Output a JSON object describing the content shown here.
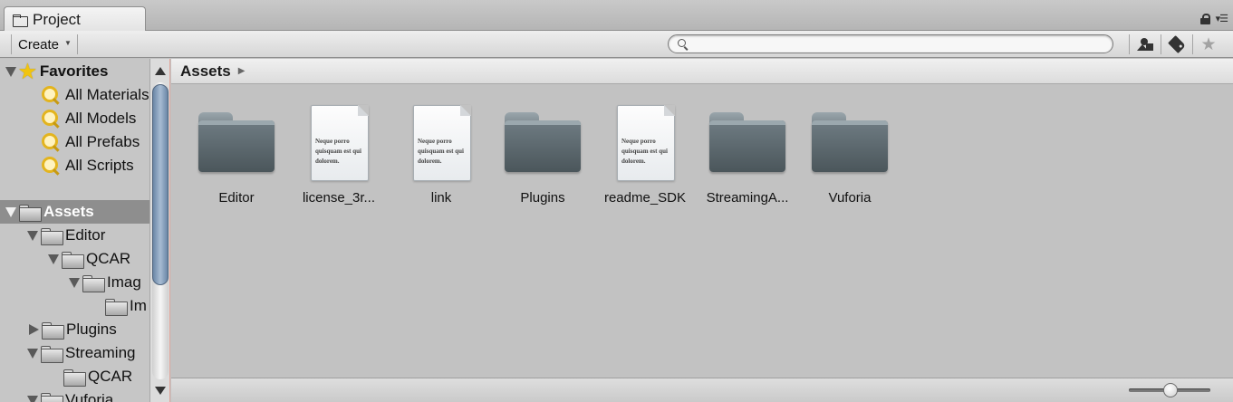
{
  "tab": {
    "title": "Project"
  },
  "toolbar": {
    "create_label": "Create",
    "search_placeholder": ""
  },
  "sidebar": {
    "favorites_label": "Favorites",
    "favorites": [
      "All Materials",
      "All Models",
      "All Prefabs",
      "All Scripts"
    ],
    "assets_label": "Assets",
    "tree": [
      {
        "label": "Editor",
        "depth": 1,
        "state": "expanded"
      },
      {
        "label": "QCAR",
        "depth": 2,
        "state": "expanded"
      },
      {
        "label": "Imag",
        "depth": 3,
        "state": "expanded"
      },
      {
        "label": "Im",
        "depth": 4,
        "state": "none"
      },
      {
        "label": "Plugins",
        "depth": 1,
        "state": "collapsed"
      },
      {
        "label": "Streaming",
        "depth": 1,
        "state": "expanded"
      },
      {
        "label": "QCAR",
        "depth": 2,
        "state": "none"
      },
      {
        "label": "Vuforia",
        "depth": 1,
        "state": "expanded"
      }
    ]
  },
  "breadcrumb": {
    "root": "Assets"
  },
  "assets": [
    {
      "label": "Editor",
      "type": "folder"
    },
    {
      "label": "license_3r...",
      "type": "text"
    },
    {
      "label": "link",
      "type": "text"
    },
    {
      "label": "Plugins",
      "type": "folder"
    },
    {
      "label": "readme_SDK",
      "type": "text"
    },
    {
      "label": "StreamingA...",
      "type": "folder"
    },
    {
      "label": "Vuforia",
      "type": "folder"
    }
  ],
  "doc_preview_text": "Neque porro quisquam est qui dolorem.",
  "zoom_level": 0.6
}
